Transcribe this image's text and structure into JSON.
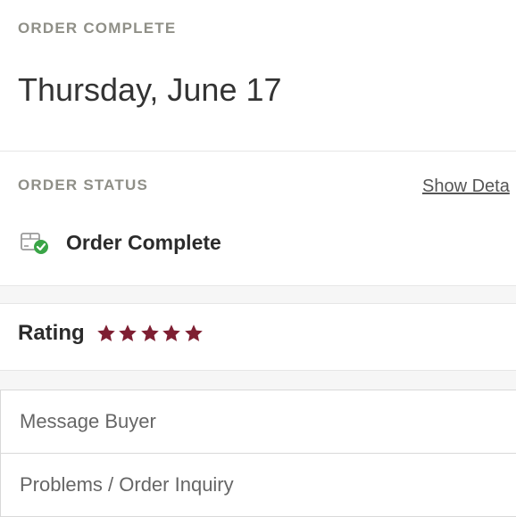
{
  "header": {
    "eyebrow": "ORDER COMPLETE",
    "date": "Thursday, June 17"
  },
  "status": {
    "eyebrow": "ORDER STATUS",
    "show_details": "Show Deta",
    "text": "Order Complete",
    "icon": "package-check-icon",
    "check_color": "#3aa547"
  },
  "rating": {
    "label": "Rating",
    "stars": 5,
    "max": 5,
    "star_color": "#7e1f32"
  },
  "actions": [
    {
      "label": "Message Buyer"
    },
    {
      "label": "Problems / Order Inquiry"
    }
  ]
}
